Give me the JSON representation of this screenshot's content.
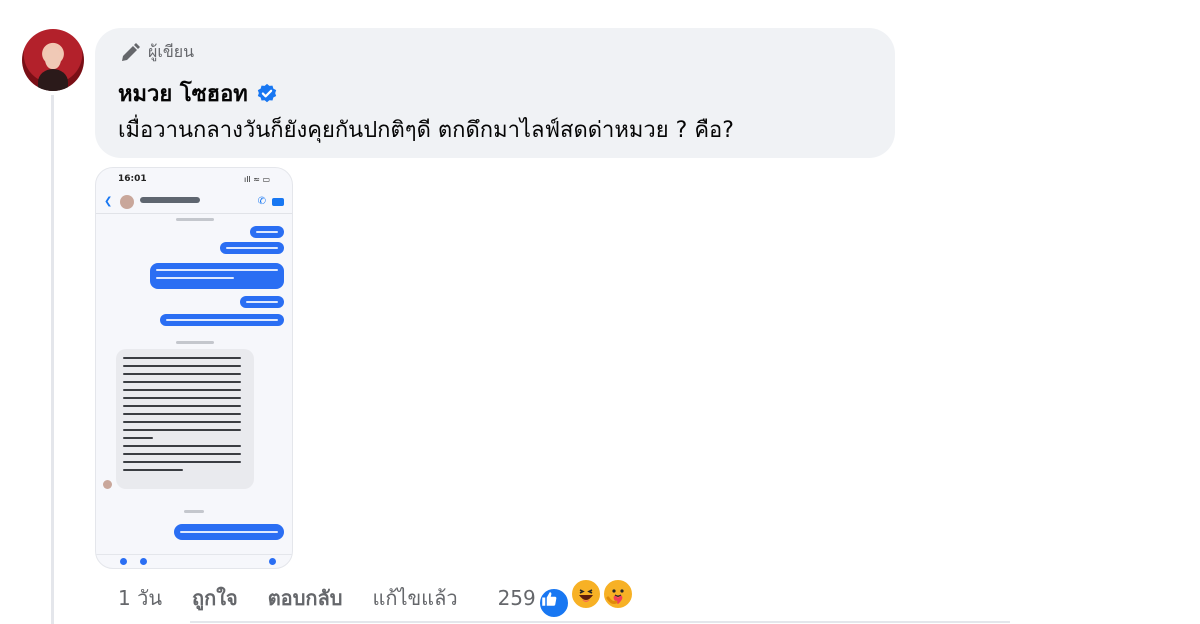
{
  "comment": {
    "author_badge": "ผู้เขียน",
    "author_name": "หมวย โซฮอท",
    "verified": true,
    "text": "เมื่อวานกลางวันก็ยังคุยกันปกติๆดี ตกดึกมาไลฟ์สดด่าหมวย ? คือ?",
    "attachment": {
      "type": "screenshot",
      "status_time": "16:01",
      "status_right": "ıll ≈ ▭"
    }
  },
  "actions": {
    "time": "1 วัน",
    "like": "ถูกใจ",
    "reply": "ตอบกลับ",
    "edited": "แก้ไขแล้ว",
    "reaction_count": "259",
    "reactions": [
      "like-icon",
      "haha-icon",
      "care-icon"
    ]
  },
  "colors": {
    "bubble": "#f0f2f5",
    "secondary_text": "#65676b",
    "brand_blue": "#1877f2",
    "reaction_yellow": "#f7b125"
  }
}
